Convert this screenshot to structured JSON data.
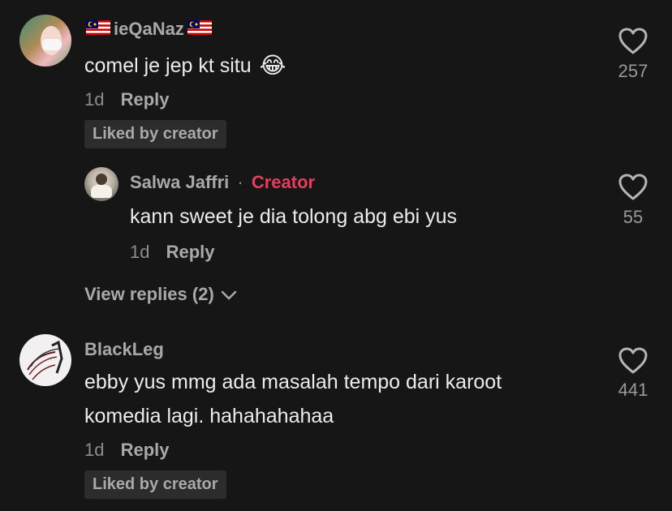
{
  "comments": [
    {
      "username": "ieQaNaz",
      "text": "comel je jep kt situ",
      "emoji": "😂",
      "time": "1d",
      "reply_label": "Reply",
      "liked_badge": "Liked by creator",
      "likes": "257"
    },
    {
      "username": "Salwa Jaffri",
      "separator": "·",
      "creator_label": "Creator",
      "text": "kann sweet je dia tolong abg ebi yus",
      "time": "1d",
      "reply_label": "Reply",
      "likes": "55"
    },
    {
      "username": "BlackLeg",
      "text_line1": "ebby yus mmg ada masalah tempo dari karoot",
      "text_line2": "komedia lagi. hahahahahaa",
      "time": "1d",
      "reply_label": "Reply",
      "liked_badge": "Liked by creator",
      "likes": "441"
    }
  ],
  "view_replies_label": "View replies (2)",
  "colors": {
    "background": "#161616",
    "creator_accent": "#ea3c5a",
    "badge_bg": "#2c2c2c"
  },
  "icons": [
    "heart-icon",
    "chevron-down-icon",
    "malaysia-flag-icon",
    "laughing-emoji"
  ]
}
